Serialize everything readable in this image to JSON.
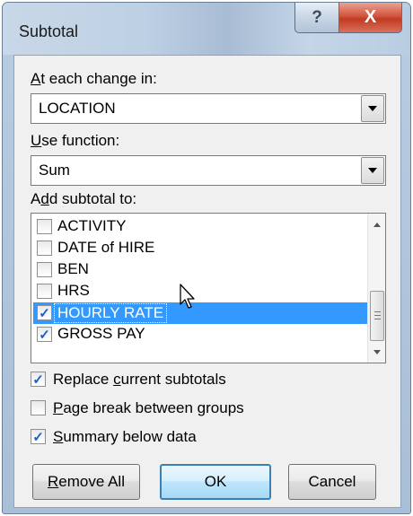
{
  "window": {
    "title": "Subtotal",
    "help_glyph": "?",
    "close_glyph": "X"
  },
  "change_in": {
    "label_hotkey": "A",
    "label_rest": "t each change in:",
    "value": "LOCATION"
  },
  "function": {
    "label_hotkey": "U",
    "label_rest": "se function:",
    "value": "Sum"
  },
  "add_subtotal": {
    "label_pre": "A",
    "label_hotkey": "d",
    "label_rest": "d subtotal to:",
    "items": [
      {
        "label": "ACTIVITY",
        "checked": false,
        "selected": false
      },
      {
        "label": "DATE of HIRE",
        "checked": false,
        "selected": false
      },
      {
        "label": "BEN",
        "checked": false,
        "selected": false
      },
      {
        "label": "HRS",
        "checked": false,
        "selected": false
      },
      {
        "label": "HOURLY RATE",
        "checked": true,
        "selected": true
      },
      {
        "label": "GROSS PAY",
        "checked": true,
        "selected": false
      }
    ]
  },
  "options": {
    "replace": {
      "pre": "Replace ",
      "hotkey": "c",
      "rest": "urrent subtotals",
      "checked": true
    },
    "page_break": {
      "pre": "",
      "hotkey": "P",
      "rest": "age break between groups",
      "checked": false
    },
    "summary": {
      "pre": "",
      "hotkey": "S",
      "rest": "ummary below data",
      "checked": true
    }
  },
  "buttons": {
    "remove_hotkey": "R",
    "remove_rest": "emove All",
    "ok": "OK",
    "cancel": "Cancel"
  },
  "check_glyph": "✓"
}
